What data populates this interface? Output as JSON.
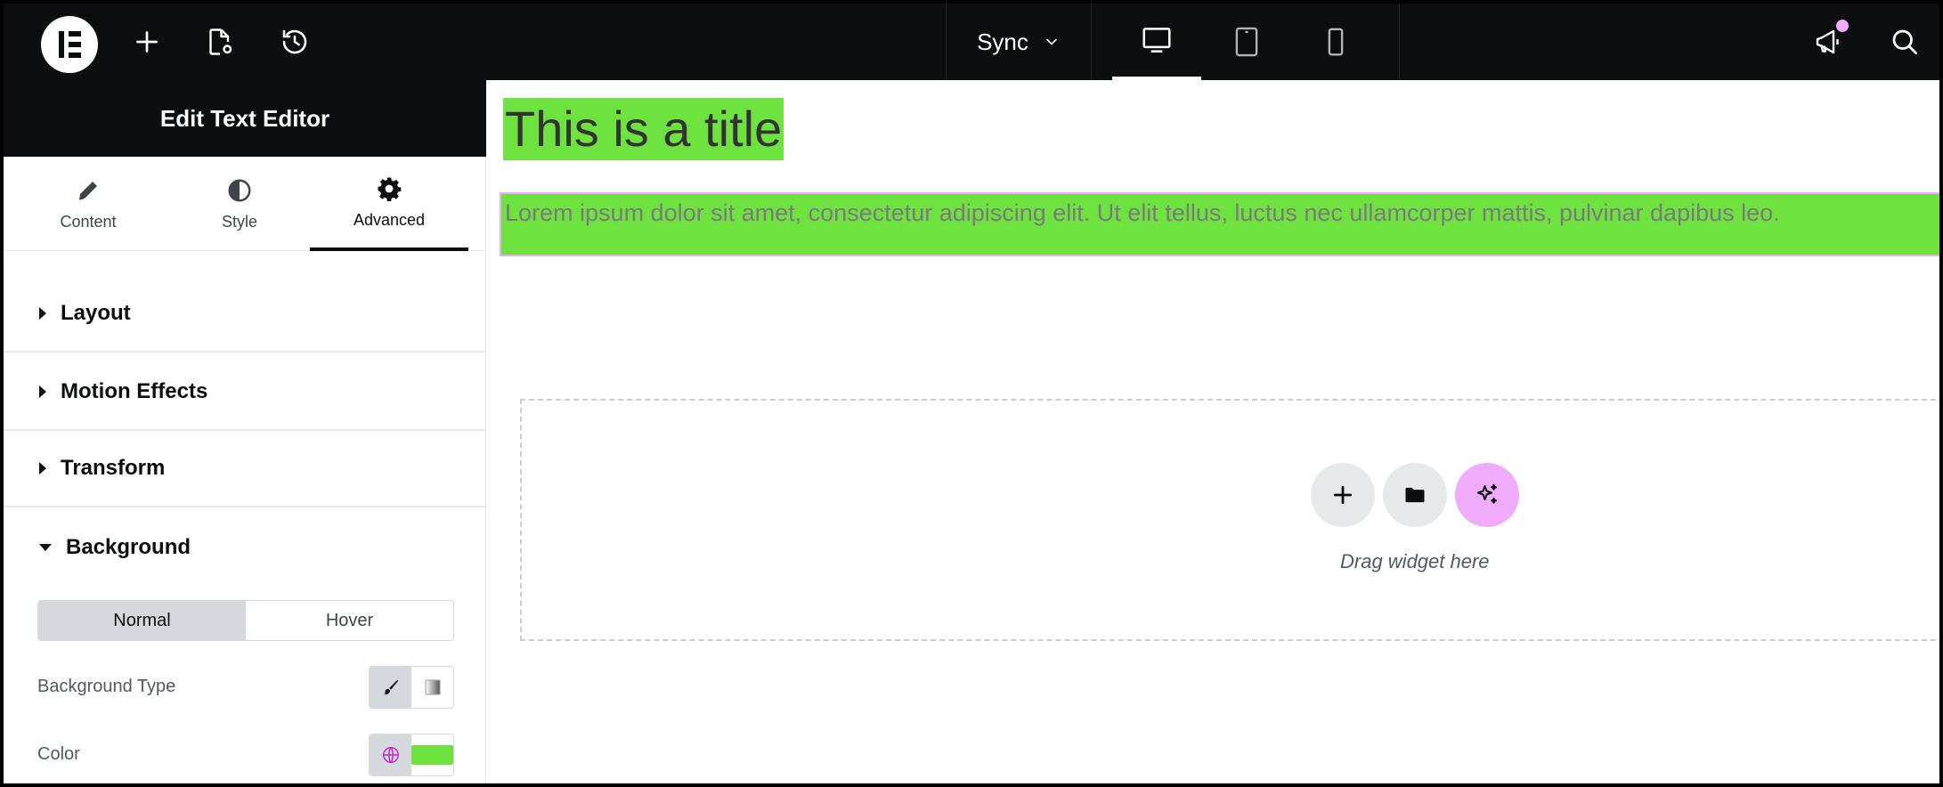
{
  "topbar": {
    "sync_label": "Sync"
  },
  "panel": {
    "title": "Edit Text Editor",
    "tabs": [
      {
        "label": "Content"
      },
      {
        "label": "Style"
      },
      {
        "label": "Advanced"
      }
    ],
    "sections": [
      {
        "label": "Layout",
        "expanded": false
      },
      {
        "label": "Motion Effects",
        "expanded": false
      },
      {
        "label": "Transform",
        "expanded": false
      },
      {
        "label": "Background",
        "expanded": true
      }
    ],
    "state_toggle": {
      "normal": "Normal",
      "hover": "Hover"
    },
    "background_type_label": "Background Type",
    "color_label": "Color",
    "color_value": "#6ee33f"
  },
  "canvas": {
    "title": "This is a title",
    "paragraph": "Lorem ipsum dolor sit amet, consectetur adipiscing elit. Ut elit tellus, luctus nec ullamcorper mattis, pulvinar dapibus leo.",
    "drop_hint": "Drag widget here"
  },
  "colors": {
    "topbar": "#0c0d0e",
    "highlight_green": "#6ee33f",
    "accent_pink": "#f0abfc"
  }
}
